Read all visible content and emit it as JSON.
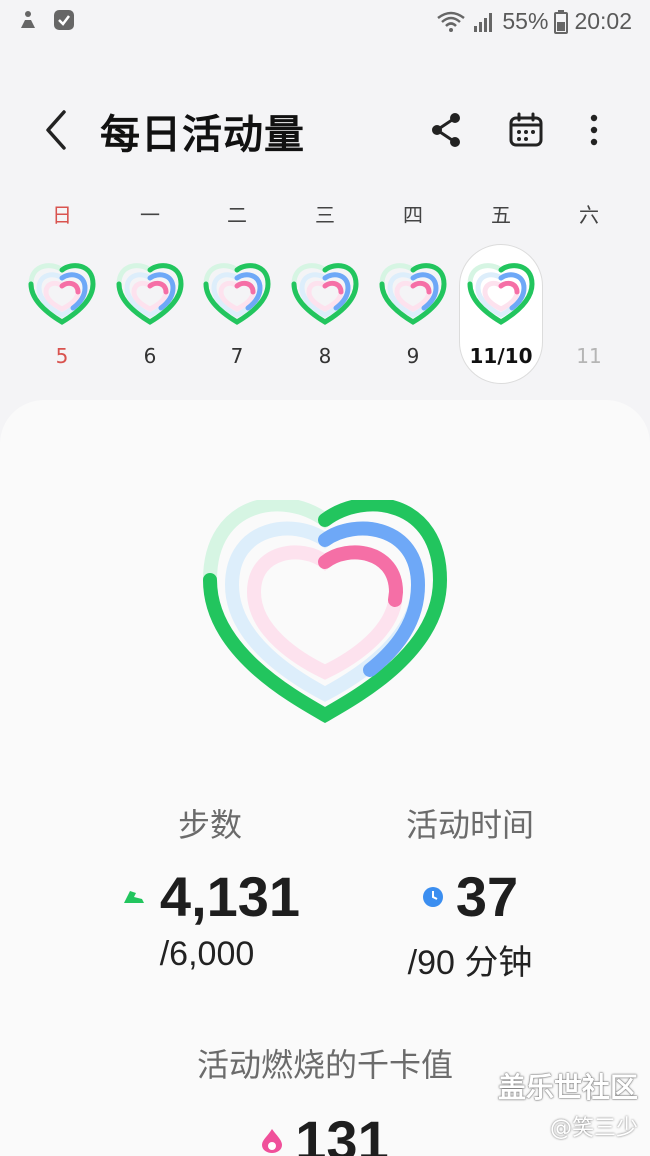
{
  "status": {
    "battery": "55%",
    "time": "20:02"
  },
  "header": {
    "title": "每日活动量"
  },
  "week": {
    "days": [
      {
        "dow": "日",
        "date": "5",
        "sunday": true
      },
      {
        "dow": "一",
        "date": "6"
      },
      {
        "dow": "二",
        "date": "7"
      },
      {
        "dow": "三",
        "date": "8"
      },
      {
        "dow": "四",
        "date": "9"
      },
      {
        "dow": "五",
        "date": "11/10",
        "selected": true
      },
      {
        "dow": "六",
        "date": "11",
        "future": true
      }
    ]
  },
  "colors": {
    "steps_ring": "#22c55e",
    "active_ring": "#6ea8f7",
    "calorie_ring": "#f56fa6",
    "sunday": "#d9534f"
  },
  "summary": {
    "steps": {
      "label": "步数",
      "value": "4,131",
      "goal": "/6,000",
      "icon": "shoe-icon"
    },
    "active": {
      "label": "活动时间",
      "value": "37",
      "goal": "/90 分钟",
      "icon": "clock-icon"
    },
    "calories": {
      "label": "活动燃烧的千卡值",
      "value": "131",
      "icon": "flame-icon"
    }
  },
  "progress": {
    "steps": 0.69,
    "active": 0.41,
    "calories": 0.45
  },
  "watermark": {
    "site": "盖乐世社区",
    "author": "@笑三少"
  }
}
